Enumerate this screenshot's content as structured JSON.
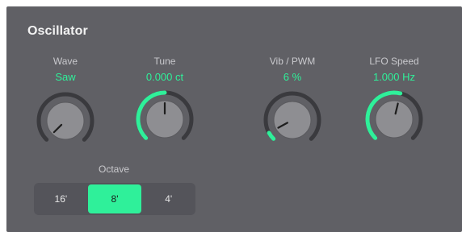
{
  "panel": {
    "title": "Oscillator"
  },
  "params": [
    {
      "label": "Wave",
      "value": "Saw",
      "level": 0.0
    },
    {
      "label": "Tune",
      "value": "0.000 ct",
      "level": 0.5
    },
    {
      "label": "Vib / PWM",
      "value": "6 %",
      "level": 0.06
    },
    {
      "label": "LFO Speed",
      "value": "1.000 Hz",
      "level": 0.55
    }
  ],
  "octave": {
    "label": "Octave",
    "options": [
      "16'",
      "8'",
      "4'"
    ],
    "selected": "8'"
  },
  "colors": {
    "accent": "#2ff09a",
    "panel": "#606065",
    "knob_ring": "#3a3a3e",
    "knob_body": "#8e8e92",
    "label": "#c9c9cd"
  }
}
